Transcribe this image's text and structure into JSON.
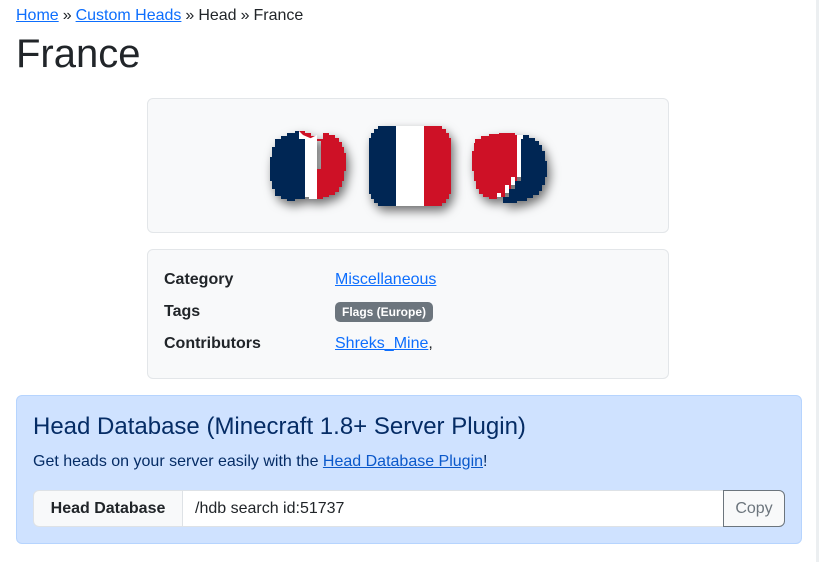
{
  "breadcrumb": {
    "items": [
      {
        "label": "Home",
        "link": true
      },
      {
        "label": "Custom Heads",
        "link": true
      },
      {
        "label": "Head",
        "link": false
      },
      {
        "label": "France",
        "link": false
      }
    ],
    "separator": "»"
  },
  "page": {
    "title": "France"
  },
  "preview": {
    "heads": [
      {
        "view": "left-angle",
        "icon": "france-flag-head-icon"
      },
      {
        "view": "front",
        "icon": "france-flag-head-icon"
      },
      {
        "view": "right-angle",
        "icon": "france-flag-head-icon"
      }
    ],
    "colors": {
      "blue": "#002654",
      "white": "#ffffff",
      "red": "#ce1126"
    }
  },
  "info": {
    "category_label": "Category",
    "category_value": "Miscellaneous",
    "tags_label": "Tags",
    "tags": [
      "Flags (Europe)"
    ],
    "contributors_label": "Contributors",
    "contributors": [
      "Shreks_Mine"
    ],
    "contributors_suffix": ","
  },
  "promo": {
    "title": "Head Database (Minecraft 1.8+ Server Plugin)",
    "text_before": "Get heads on your server easily with the ",
    "link_text": "Head Database Plugin",
    "text_after": "!",
    "input_prefix": "Head Database",
    "command": "/hdb search id:51737",
    "copy_label": "Copy"
  },
  "theme": {
    "link": "#0d6efd",
    "alert_bg": "#cfe2ff",
    "alert_border": "#b6d4fe",
    "alert_text": "#052c65",
    "badge": "#6c757d"
  }
}
